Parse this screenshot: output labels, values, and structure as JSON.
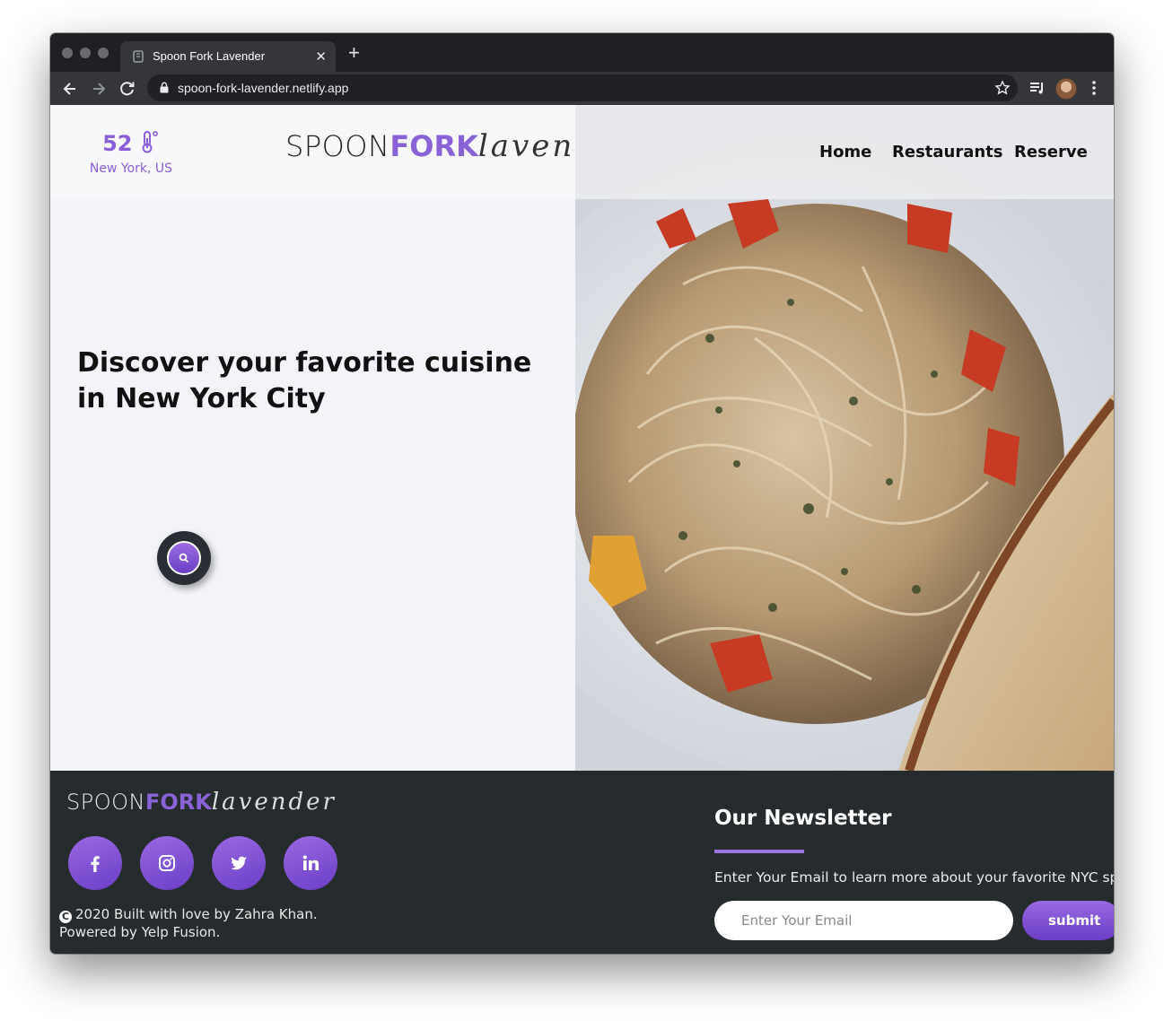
{
  "browser": {
    "tab_title": "Spoon Fork Lavender",
    "url": "spoon-fork-lavender.netlify.app"
  },
  "weather": {
    "temperature": "52",
    "location": "New York, US"
  },
  "logo": {
    "spoon": "SPOON",
    "fork": "FORK",
    "script": "lavender"
  },
  "nav": {
    "items": [
      {
        "label": "Home"
      },
      {
        "label": "Restaurants"
      },
      {
        "label": "Reserve"
      }
    ]
  },
  "hero": {
    "title_line1": "Discover your favorite cuisine",
    "title_line2": "in New York City"
  },
  "footer": {
    "copyright_line1": "2020 Built with love by Zahra Khan.",
    "copyright_line2": "Powered by Yelp Fusion.",
    "newsletter": {
      "title": "Our Newsletter",
      "description": "Enter Your Email to learn more about your favorite NYC spot",
      "placeholder": "Enter Your Email",
      "submit_label": "submit"
    },
    "social": [
      "facebook-icon",
      "instagram-icon",
      "twitter-icon",
      "linkedin-icon"
    ]
  },
  "colors": {
    "accent": "#8a62d8",
    "footer_bg": "#262b2e",
    "hero_bg": "#f3f4f9"
  }
}
